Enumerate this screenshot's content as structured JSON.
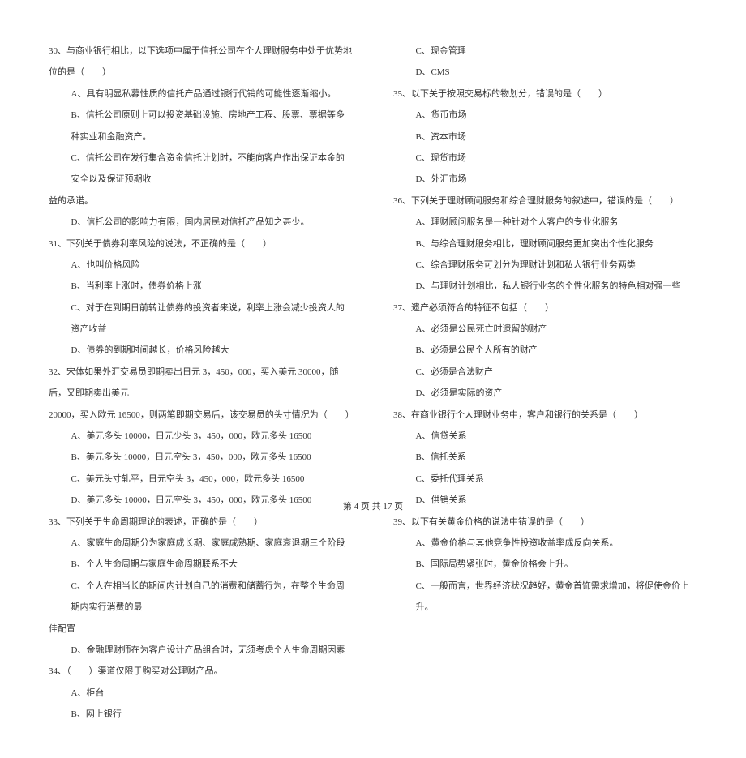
{
  "left": {
    "q30": "30、与商业银行相比，以下选项中属于信托公司在个人理财服务中处于优势地位的是（　　）",
    "q30a": "A、具有明显私募性质的信托产品通过银行代销的可能性逐渐缩小。",
    "q30b": "B、信托公司原则上可以投资基础设施、房地产工程、股票、票据等多种实业和金融资产。",
    "q30c": "C、信托公司在发行集合资金信托计划时，不能向客户作出保证本金的安全以及保证预期收",
    "q30c2": "益的承诺。",
    "q30d": "D、信托公司的影响力有限，国内居民对信托产品知之甚少。",
    "q31": "31、下列关于债券利率风险的说法，不正确的是（　　）",
    "q31a": "A、也叫价格风险",
    "q31b": "B、当利率上涨时，债券价格上涨",
    "q31c": "C、对于在到期日前转让债券的投资者来说，利率上涨会减少投资人的资产收益",
    "q31d": "D、债券的到期时间越长，价格风险越大",
    "q32": "32、宋体如果外汇交易员即期卖出日元 3，450，000，买入美元 30000，随后，又即期卖出美元",
    "q32_2": "20000，买入欧元 16500，则两笔即期交易后，该交易员的头寸情况为（　　）",
    "q32a": "A、美元多头 10000，日元少头 3，450，000，欧元多头 16500",
    "q32b": "B、美元多头 10000，日元空头 3，450，000，欧元多头 16500",
    "q32c": "C、美元头寸轧平，日元空头 3，450，000，欧元多头 16500",
    "q32d": "D、美元多头 10000，日元空头 3，450，000，欧元多头 16500",
    "q33": "33、下列关于生命周期理论的表述，正确的是（　　）",
    "q33a": "A、家庭生命周期分为家庭成长期、家庭成熟期、家庭衰退期三个阶段",
    "q33b": "B、个人生命周期与家庭生命周期联系不大",
    "q33c": "C、个人在相当长的期间内计划自己的消费和储蓄行为，在整个生命周期内实行消费的最",
    "q33c2": "佳配置",
    "q33d": "D、金融理财师在为客户设计产品组合时，无须考虑个人生命周期因素",
    "q34": "34、（　　）渠道仅限于购买对公理财产品。",
    "q34a": "A、柜台",
    "q34b": "B、网上银行"
  },
  "right": {
    "q34c": "C、现金管理",
    "q34d": "D、CMS",
    "q35": "35、以下关于按照交易标的物划分，错误的是（　　）",
    "q35a": "A、货币市场",
    "q35b": "B、资本市场",
    "q35c": "C、现货市场",
    "q35d": "D、外汇市场",
    "q36": "36、下列关于理财顾问服务和综合理财服务的叙述中，错误的是（　　）",
    "q36a": "A、理财顾问服务是一种针对个人客户的专业化服务",
    "q36b": "B、与综合理财服务相比，理财顾问服务更加突出个性化服务",
    "q36c": "C、综合理财服务可划分为理财计划和私人银行业务两类",
    "q36d": "D、与理财计划相比，私人银行业务的个性化服务的特色相对强一些",
    "q37": "37、遗产必须符合的特征不包括（　　）",
    "q37a": "A、必须是公民死亡时遗留的财产",
    "q37b": "B、必须是公民个人所有的财产",
    "q37c": "C、必须是合法财产",
    "q37d": "D、必须是实际的资产",
    "q38": "38、在商业银行个人理财业务中，客户和银行的关系是（　　）",
    "q38a": "A、信贷关系",
    "q38b": "B、信托关系",
    "q38c": "C、委托代理关系",
    "q38d": "D、供销关系",
    "q39": "39、以下有关黄金价格的说法中错误的是（　　）",
    "q39a": "A、黄金价格与其他竞争性投资收益率成反向关系。",
    "q39b": "B、国际局势紧张时，黄金价格会上升。",
    "q39c": "C、一般而言，世界经济状况趋好，黄金首饰需求增加，将促使金价上升。"
  },
  "footer": "第 4 页 共 17 页"
}
